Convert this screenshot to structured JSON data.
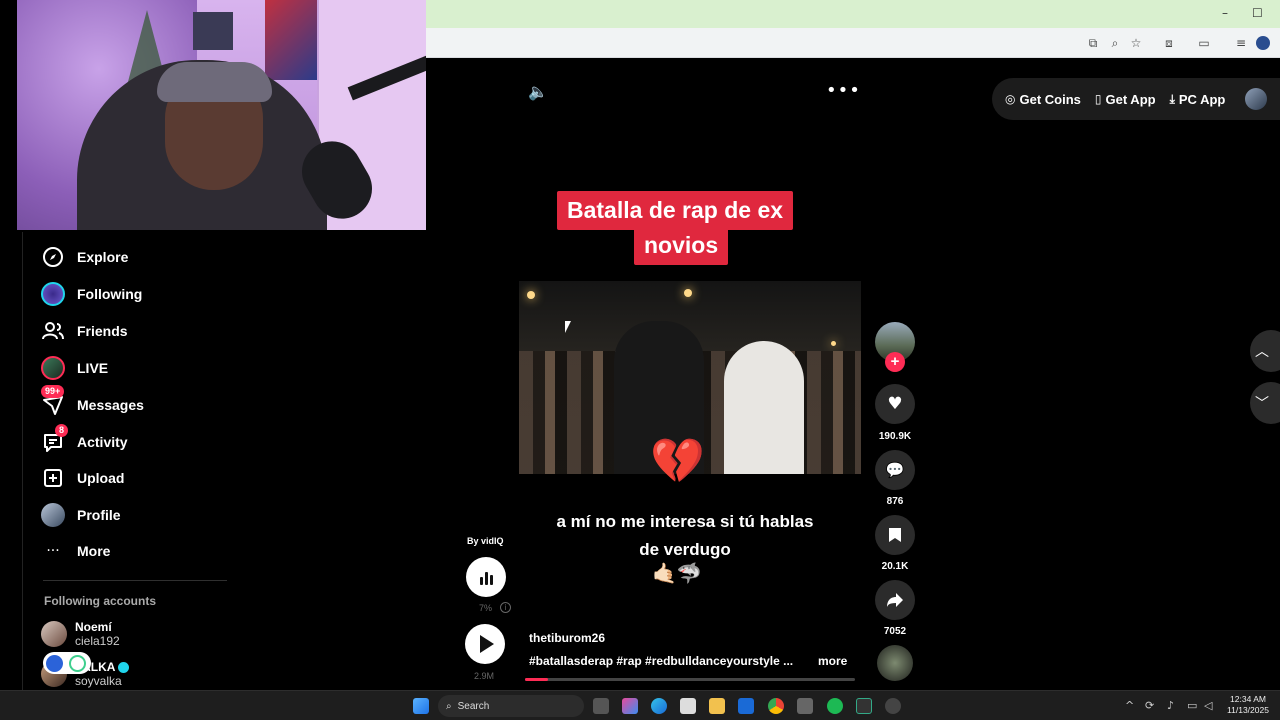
{
  "browser": {
    "minimize_glyph": "–",
    "maximize_glyph": "☐"
  },
  "sidebar": {
    "items": [
      {
        "label": "Explore",
        "icon": "compass-icon"
      },
      {
        "label": "Following",
        "icon": "following-avatar-icon"
      },
      {
        "label": "Friends",
        "icon": "friends-icon"
      },
      {
        "label": "LIVE",
        "icon": "live-avatar-icon"
      },
      {
        "label": "Messages",
        "icon": "messages-icon",
        "badge": "99+"
      },
      {
        "label": "Activity",
        "icon": "activity-icon",
        "badge": "8"
      },
      {
        "label": "Upload",
        "icon": "upload-icon"
      },
      {
        "label": "Profile",
        "icon": "profile-avatar-icon"
      },
      {
        "label": "More",
        "icon": "more-dots-icon"
      }
    ],
    "following_title": "Following accounts",
    "accounts": [
      {
        "name": "Noemí",
        "handle": "ciela192"
      },
      {
        "name": "VALKA",
        "handle": "soyvalka",
        "verified": true
      }
    ]
  },
  "header": {
    "get_coins": "Get Coins",
    "get_app": "Get App",
    "pc_app": "PC App"
  },
  "video": {
    "title_line1": "Batalla de rap de ex",
    "title_line2": "novios",
    "caption_line1": "a mí no me interesa si tú hablas",
    "caption_line2": "de verdugo",
    "emojis": "🤙🏻🦈",
    "progress": 0.07
  },
  "vidiq": {
    "by": "By vidIQ",
    "percent": "7%",
    "info_glyph": "i",
    "views": "2.9M"
  },
  "post": {
    "author": "thetiburom26",
    "hashtags": "#batallasderap  #rap  #redbulldanceyourstyle  ...",
    "more": "more"
  },
  "actions": {
    "follow_glyph": "+",
    "likes": "190.9K",
    "comments": "876",
    "saves": "20.1K",
    "shares": "7052"
  },
  "taskbar": {
    "search": "Search",
    "time": "12:34 AM",
    "date": "11/13/2025"
  },
  "colors": {
    "accent": "#fe2c55",
    "title_bg": "#e0283e",
    "background": "#000000"
  }
}
